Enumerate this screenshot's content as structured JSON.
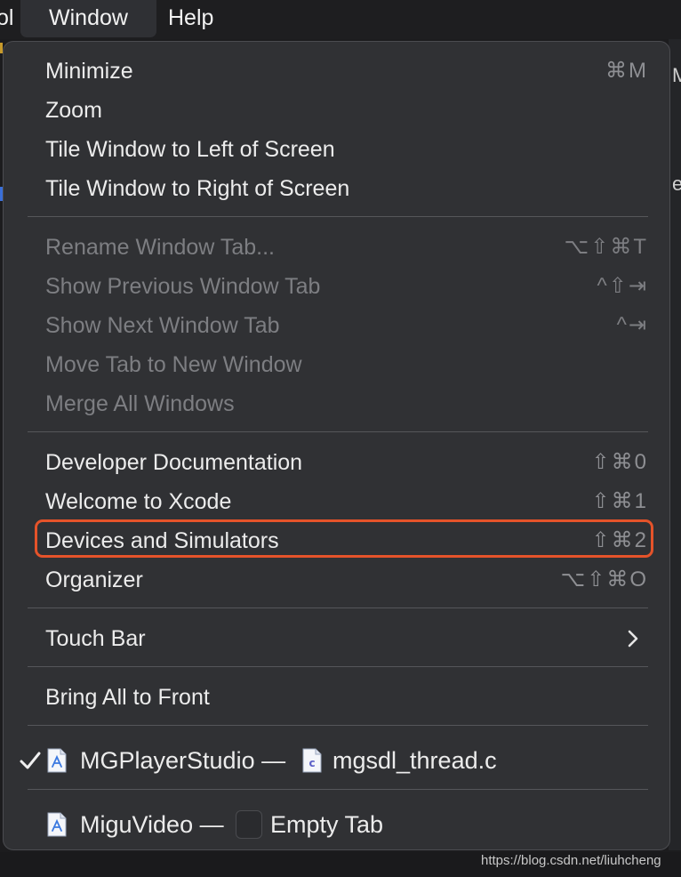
{
  "menubar": {
    "partial_label": "ol",
    "window_label": "Window",
    "help_label": "Help"
  },
  "background": {
    "edge_chars": [
      "M",
      "e"
    ]
  },
  "menu": {
    "group1": [
      {
        "label": "Minimize",
        "shortcut": "⌘M"
      },
      {
        "label": "Zoom",
        "shortcut": ""
      },
      {
        "label": "Tile Window to Left of Screen",
        "shortcut": ""
      },
      {
        "label": "Tile Window to Right of Screen",
        "shortcut": ""
      }
    ],
    "group2": [
      {
        "label": "Rename Window Tab...",
        "shortcut": "⌥⇧⌘T"
      },
      {
        "label": "Show Previous Window Tab",
        "shortcut": "^⇧⇥"
      },
      {
        "label": "Show Next Window Tab",
        "shortcut": "^⇥"
      },
      {
        "label": "Move Tab to New Window",
        "shortcut": ""
      },
      {
        "label": "Merge All Windows",
        "shortcut": ""
      }
    ],
    "group3": [
      {
        "label": "Developer Documentation",
        "shortcut": "⇧⌘0"
      },
      {
        "label": "Welcome to Xcode",
        "shortcut": "⇧⌘1"
      },
      {
        "label": "Devices and Simulators",
        "shortcut": "⇧⌘2"
      },
      {
        "label": "Organizer",
        "shortcut": "⌥⇧⌘O"
      }
    ],
    "touch_bar": {
      "label": "Touch Bar",
      "icon": "chevron-right-icon"
    },
    "bring_all": {
      "label": "Bring All to Front"
    },
    "windows": [
      {
        "project": "MGPlayerStudio —",
        "file": "mgsdl_thread.c",
        "checked": true
      },
      {
        "project": "MiguVideo —",
        "file": "Empty Tab",
        "checked": false
      }
    ],
    "highlight_color": "#e5532a"
  },
  "watermark": "https://blog.csdn.net/liuhcheng"
}
